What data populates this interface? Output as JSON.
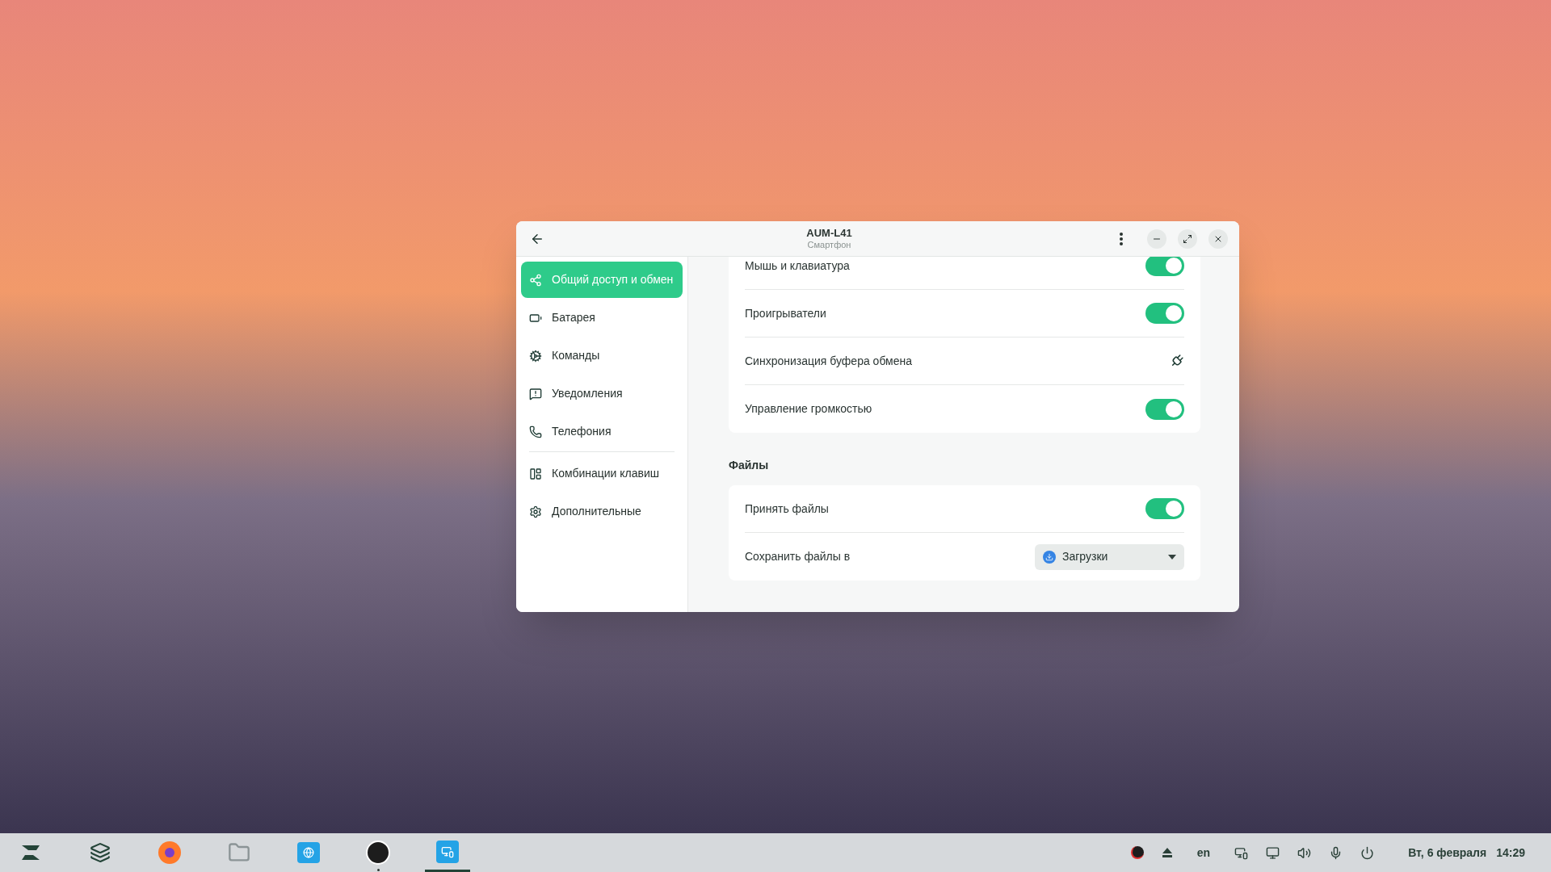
{
  "window": {
    "title": "AUM-L41",
    "subtitle": "Смартфон"
  },
  "sidebar": {
    "groups": [
      [
        {
          "label": "Общий доступ и обмен",
          "selected": true
        },
        {
          "label": "Батарея",
          "selected": false
        },
        {
          "label": "Команды",
          "selected": false
        },
        {
          "label": "Уведомления",
          "selected": false
        },
        {
          "label": "Телефония",
          "selected": false
        }
      ],
      [
        {
          "label": "Комбинации клавиш",
          "selected": false
        },
        {
          "label": "Дополнительные",
          "selected": false
        }
      ]
    ]
  },
  "sections": [
    {
      "rows": [
        {
          "kind": "switch",
          "label": "Мышь и клавиатура",
          "on": true
        },
        {
          "kind": "switch",
          "label": "Проигрыватели",
          "on": true
        },
        {
          "kind": "action",
          "label": "Синхронизация буфера обмена"
        },
        {
          "kind": "switch",
          "label": "Управление громкостью",
          "on": true
        }
      ]
    },
    {
      "title": "Файлы",
      "rows": [
        {
          "kind": "switch",
          "label": "Принять файлы",
          "on": true
        },
        {
          "kind": "dropdown",
          "label": "Сохранить файлы в",
          "value": "Загрузки"
        }
      ]
    }
  ],
  "taskbar": {
    "apps": [
      {
        "running": false,
        "active": false
      },
      {
        "running": false,
        "active": false
      },
      {
        "running": false,
        "active": false
      },
      {
        "running": false,
        "active": false
      },
      {
        "running": false,
        "active": false
      },
      {
        "running": true,
        "active": false
      },
      {
        "running": true,
        "active": true
      }
    ],
    "language": "en",
    "date": "Вт, 6 февраля",
    "time": "14:29"
  }
}
